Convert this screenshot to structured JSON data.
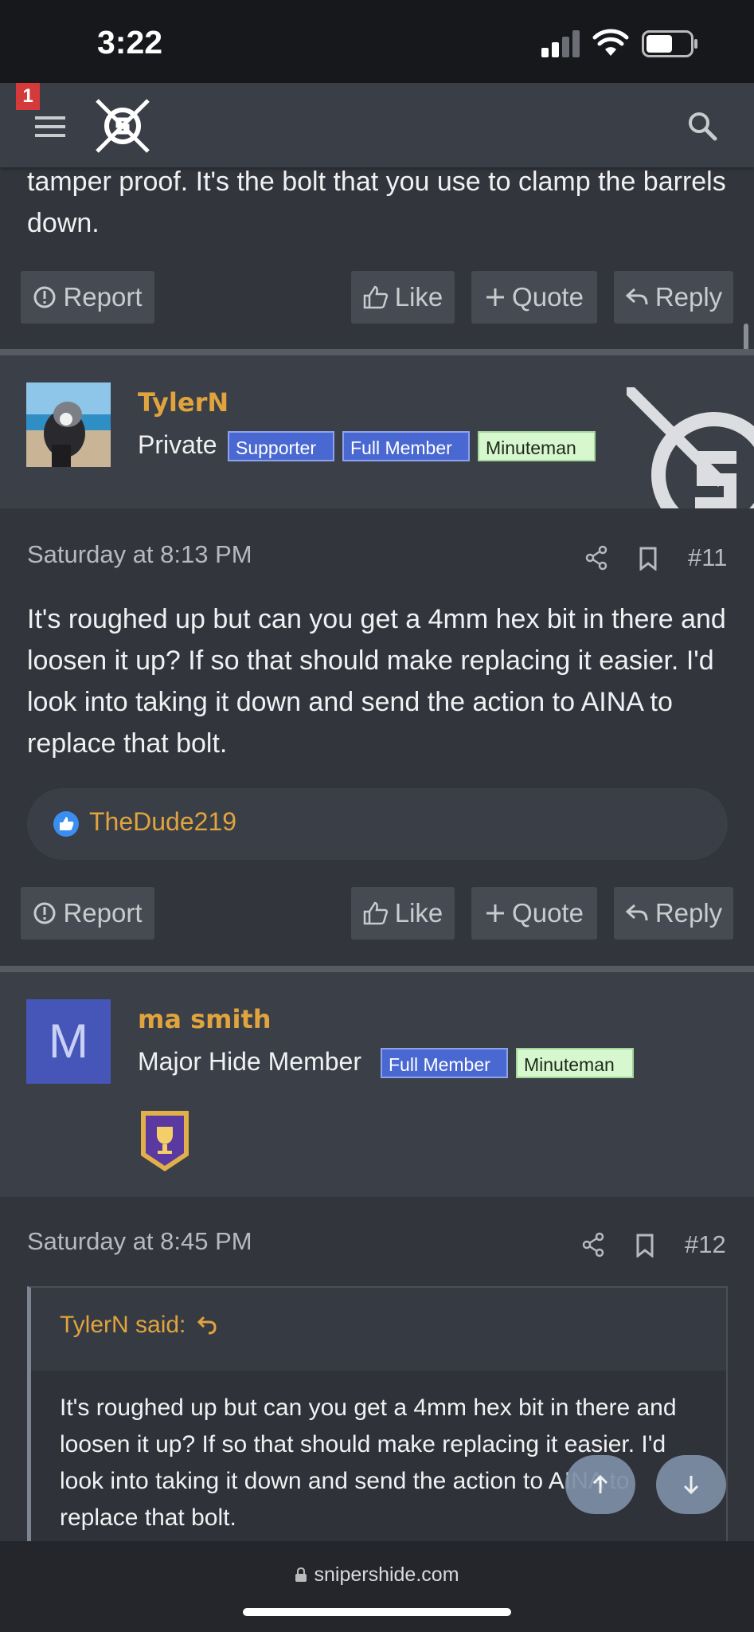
{
  "status_bar": {
    "time": "3:22"
  },
  "nav": {
    "notification_count": "1"
  },
  "top_post": {
    "text": "tamper proof. It's the bolt that you use to clamp the barrels down.",
    "actions": {
      "report": "Report",
      "like": "Like",
      "quote": "Quote",
      "reply": "Reply"
    }
  },
  "post_11": {
    "username": "TylerN",
    "user_title": "Private",
    "badges": [
      "Supporter",
      "Full Member",
      "Minuteman"
    ],
    "date": "Saturday at 8:13 PM",
    "number": "#11",
    "text": "It's roughed up but can you get a 4mm hex bit in there and loosen it up? If so that should make replacing it easier. I'd look into taking it down and send the action to AINA to replace that bolt.",
    "reaction_user": "TheDude219",
    "actions": {
      "report": "Report",
      "like": "Like",
      "quote": "Quote",
      "reply": "Reply"
    }
  },
  "post_12": {
    "username": "ma smith",
    "avatar_letter": "M",
    "user_title": "Major Hide Member",
    "badges": [
      "Full Member",
      "Minuteman"
    ],
    "date": "Saturday at 8:45 PM",
    "number": "#12",
    "quote_author": "TylerN said:",
    "quote_text": "It's roughed up but can you get a 4mm hex bit in there and loosen it up? If so that should make replacing it easier. I'd look into taking it down and send the action to AINA to replace that bolt."
  },
  "browser": {
    "url": "snipershide.com"
  },
  "colors": {
    "accent": "#e0a43e",
    "badge_blue": "#4a68d2",
    "badge_green": "#d7f7cf",
    "avatar_m": "#4656b8"
  }
}
